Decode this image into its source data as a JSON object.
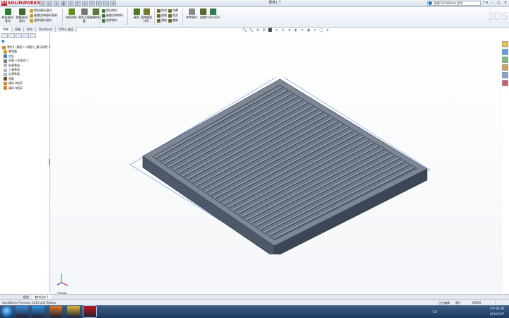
{
  "app": {
    "logo_text": "SOLIDWORKS",
    "logo_badge": "DS",
    "document_title": "零件1 *",
    "search_placeholder": "搜尋 SolidWorks 說明",
    "help_icons": [
      "?",
      "▾"
    ],
    "window_buttons": [
      "–",
      "▢",
      "✕"
    ]
  },
  "quick_access": [
    "⌂",
    "▭",
    "▾",
    "⎙",
    "▾",
    "↶",
    "▾",
    "↖",
    "▾",
    "▭",
    "▾"
  ],
  "ribbon": {
    "big_buttons": [
      {
        "label": "伸長填料/基材",
        "color": "#2e7d32"
      },
      {
        "label": "旋轉填料/基材",
        "color": "#3e6b2a"
      },
      {
        "label": "伸長除料",
        "color": "#6b8e23"
      },
      {
        "label": "異型孔精靈",
        "color": "#777777"
      },
      {
        "label": "旋轉除料",
        "color": "#5d7a2e"
      },
      {
        "label": "圓角",
        "color": "#4a7a2e"
      },
      {
        "label": "直線複製排列",
        "color": "#7a7a2e"
      },
      {
        "label": "參考幾何",
        "color": "#8a8a8a"
      },
      {
        "label": "曲線",
        "color": "#556b2f"
      },
      {
        "label": "Instant3D",
        "color": "#2f7d4a"
      }
    ],
    "small_buttons": [
      {
        "label": "掃出填料/基材",
        "color": "#c9a227"
      },
      {
        "label": "疊層拉伸填料/基材",
        "color": "#c9a227"
      },
      {
        "label": "邊界填料/基材",
        "color": "#c9a227"
      },
      {
        "label": "掃出除料",
        "color": "#3b7a3b"
      },
      {
        "label": "疊層拉伸除料",
        "color": "#3b7a3b"
      },
      {
        "label": "邊界除料",
        "color": "#3b7a3b"
      },
      {
        "label": "肋材",
        "color": "#6b6b2a"
      },
      {
        "label": "拔模",
        "color": "#6b6b2a"
      },
      {
        "label": "薄殼",
        "color": "#6b6b2a"
      },
      {
        "label": "包覆",
        "color": "#6b6b2a"
      },
      {
        "label": "相交",
        "color": "#6b6b2a"
      },
      {
        "label": "鏡射",
        "color": "#6b6b2a"
      }
    ]
  },
  "command_tabs": [
    "特徵",
    "草圖",
    "評估",
    "DimXpert",
    "Office 產品"
  ],
  "panel_icons": [
    "",
    "",
    "",
    "",
    ""
  ],
  "filter_icon": "▼",
  "tree": [
    {
      "label": "零件1 (預設<<預設>_顯示狀態 1>)",
      "color": "#d38b1e"
    },
    {
      "label": "感測器",
      "color": "#c9a227"
    },
    {
      "label": "註記",
      "color": "#4c7bbf"
    },
    {
      "label": "材質 <未指定>",
      "color": "#7a7a7a"
    },
    {
      "label": "前基準面",
      "color": "#a9b7c6"
    },
    {
      "label": "上基準面",
      "color": "#a9b7c6"
    },
    {
      "label": "右基準面",
      "color": "#a9b7c6"
    },
    {
      "label": "原點",
      "color": "#6b4a2a"
    },
    {
      "label": "填料-伸長1",
      "color": "#d38b1e"
    },
    {
      "label": "填料-伸長2",
      "color": "#d38b1e"
    }
  ],
  "view_toolbar": [
    "🔍",
    "🔍",
    "⊕",
    "⊞",
    "⬛",
    "▾",
    "⊙",
    "▾",
    "◐",
    "▾",
    "◉",
    "▾",
    "▢",
    "▾"
  ],
  "task_pane_colors": [
    "#f0c040",
    "#5fa0e0",
    "#7cc070",
    "#e0a050",
    "#90a0d0",
    "#d06060"
  ],
  "watermark": "3DS",
  "model": {
    "slat_count": 26,
    "accent": "#5b6c7f"
  },
  "view_label": "*等角視",
  "model_tabs": [
    "模型",
    "動作研究 1"
  ],
  "status": {
    "product": "SolidWorks Premium 2013 x64 Edition",
    "mode": "正在編輯",
    "doc": "零件",
    "units": "MMGS",
    "help": "?"
  },
  "taskbar": {
    "apps": [
      {
        "name": "explorer",
        "color": "#3a8ad8"
      },
      {
        "name": "ie",
        "color": "#2a9ae0"
      },
      {
        "name": "media",
        "color": "#e07a2a"
      },
      {
        "name": "folder",
        "color": "#e0b83a"
      },
      {
        "name": "solidworks",
        "color": "#c0141b"
      }
    ],
    "tray_lang": "CH",
    "time": "下午 01:46",
    "date": "2014/7/27"
  }
}
